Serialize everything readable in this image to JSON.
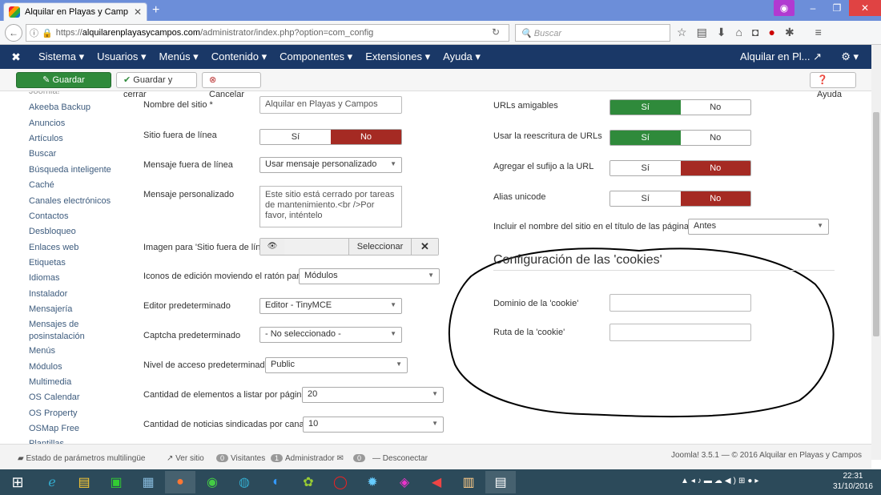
{
  "browser": {
    "tab_title": "Alquilar en Playas y Camp...",
    "url_prefix": "https://",
    "url_domain": "alquilarenplayasycampos.com",
    "url_path": "/administrator/index.php?option=com_config",
    "search_placeholder": "Buscar"
  },
  "joomla_nav": {
    "items": [
      "Sistema ▾",
      "Usuarios ▾",
      "Menús ▾",
      "Contenido ▾",
      "Componentes ▾",
      "Extensiones ▾",
      "Ayuda ▾"
    ],
    "site_link": "Alquilar en Pl...",
    "gear": "⚙ ▾"
  },
  "toolbar": {
    "save": "Guardar",
    "save_close": "Guardar y cerrar",
    "cancel": "Cancelar",
    "help": "Ayuda"
  },
  "sidebar": {
    "cut_top": "Joomla!",
    "items": [
      "Akeeba Backup",
      "Anuncios",
      "Artículos",
      "Buscar",
      "Búsqueda inteligente",
      "Caché",
      "Canales electrónicos",
      "Contactos",
      "Desbloqueo",
      "Enlaces web",
      "Etiquetas",
      "Idiomas",
      "Instalador",
      "Mensajería",
      "Mensajes de",
      "posinstalación",
      "Menús",
      "Módulos",
      "Multimedia",
      "OS Calendar",
      "OS Property",
      "OSMap Free",
      "Plantillas"
    ]
  },
  "form_left": {
    "site_name_label": "Nombre del sitio *",
    "site_name_value": "Alquilar en Playas y Campos",
    "offline_label": "Sitio fuera de línea",
    "offline_yes": "Sí",
    "offline_no": "No",
    "offline_msg_label": "Mensaje fuera de línea",
    "offline_msg_value": "Usar mensaje personalizado",
    "custom_msg_label": "Mensaje personalizado",
    "custom_msg_value": "Este sitio está cerrado por tareas de mantenimiento.<br />Por favor, inténtelo",
    "offline_img_label": "Imagen para 'Sitio fuera de línea'",
    "offline_img_select": "Seleccionar",
    "edit_icons_label": "Iconos de edición moviendo el ratón para",
    "edit_icons_value": "Módulos",
    "editor_label": "Editor predeterminado",
    "editor_value": "Editor - TinyMCE",
    "captcha_label": "Captcha predeterminado",
    "captcha_value": "- No seleccionado -",
    "access_label": "Nivel de acceso predeterminado",
    "access_value": "Public",
    "list_limit_label": "Cantidad de elementos a listar por página",
    "list_limit_value": "20",
    "feed_limit_label": "Cantidad de noticias sindicadas por canal",
    "feed_limit_value": "10"
  },
  "form_right": {
    "sef_label": "URLs amigables",
    "rewrite_label": "Usar la reescritura de URLs",
    "suffix_label": "Agregar el sufijo a la URL",
    "unicode_label": "Alias unicode",
    "yes": "Sí",
    "no": "No",
    "sitename_title_label": "Incluir el nombre del sitio en el título de las páginas",
    "sitename_title_value": "Antes",
    "cookie_heading": "Configuración de las 'cookies'",
    "cookie_domain_label": "Dominio de la 'cookie'",
    "cookie_path_label": "Ruta de la 'cookie'"
  },
  "statusbar": {
    "multilang": "Estado de parámetros multilingüe",
    "view_site": "Ver sitio",
    "visitors_count": "0",
    "visitors": "Visitantes",
    "admin_count": "1",
    "admin": "Administrador",
    "msg_count": "0",
    "logout": "Desconectar",
    "footer": "Joomla! 3.5.1 — © 2016 Alquilar en Playas y Campos"
  },
  "taskbar": {
    "time": "22:31",
    "date": "31/10/2016"
  }
}
